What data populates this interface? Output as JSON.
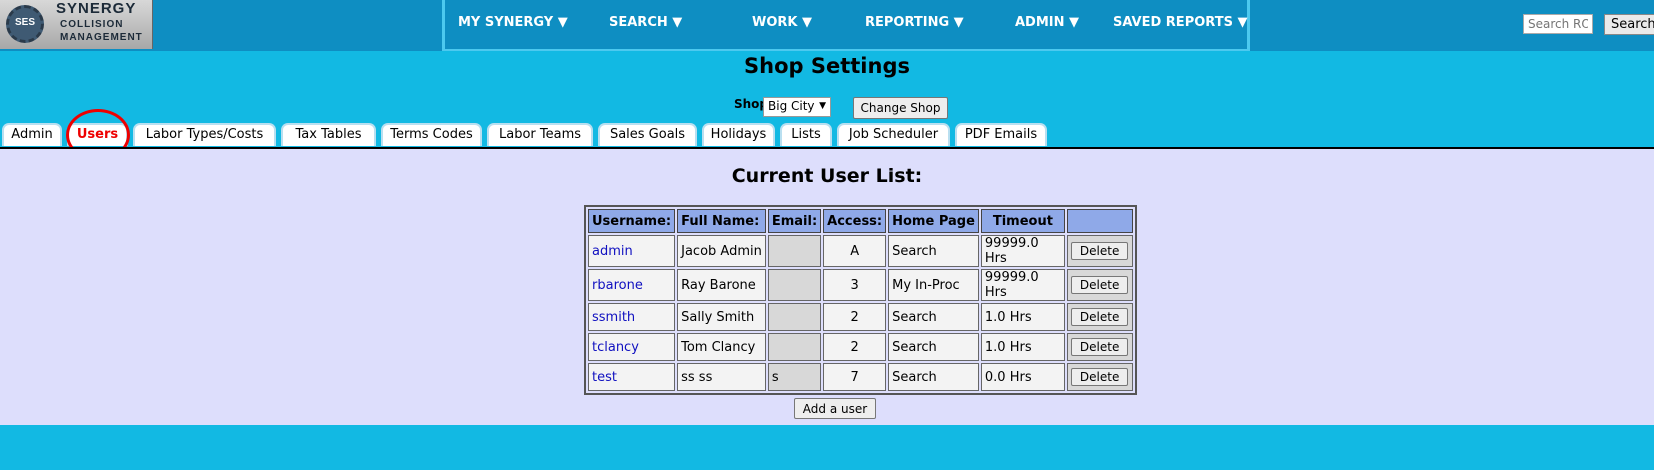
{
  "logo": {
    "mark": "SES",
    "line1": "SYNERGY",
    "line2": "COLLISION",
    "line3": "MANAGEMENT"
  },
  "nav": {
    "items": [
      {
        "label": "MY SYNERGY ▼"
      },
      {
        "label": "SEARCH ▼"
      },
      {
        "label": "WORK ▼"
      },
      {
        "label": "REPORTING ▼"
      },
      {
        "label": "ADMIN ▼"
      },
      {
        "label": "SAVED REPORTS ▼"
      }
    ],
    "search_placeholder": "Search RO",
    "search_button": "Search"
  },
  "page": {
    "title": "Shop Settings",
    "shop_label": "Shop:",
    "shop_value": "Big City",
    "change_shop_button": "Change Shop"
  },
  "tabs": [
    {
      "label": "Admin"
    },
    {
      "label": "Users",
      "active": true
    },
    {
      "label": "Labor Types/Costs"
    },
    {
      "label": "Tax Tables"
    },
    {
      "label": "Terms Codes"
    },
    {
      "label": "Labor Teams"
    },
    {
      "label": "Sales Goals"
    },
    {
      "label": "Holidays"
    },
    {
      "label": "Lists"
    },
    {
      "label": "Job Scheduler"
    },
    {
      "label": "PDF Emails"
    }
  ],
  "user_list": {
    "title": "Current User List:",
    "headers": [
      "Username:",
      "Full Name:",
      "Email:",
      "Access:",
      "Home Page",
      "Timeout",
      ""
    ],
    "rows": [
      {
        "username": "admin",
        "full_name": "Jacob Admin",
        "email": "",
        "access": "A",
        "home_page": "Search",
        "timeout": "99999.0 Hrs",
        "delete": "Delete"
      },
      {
        "username": "rbarone",
        "full_name": "Ray Barone",
        "email": "",
        "access": "3",
        "home_page": "My In-Proc",
        "timeout": "99999.0 Hrs",
        "delete": "Delete"
      },
      {
        "username": "ssmith",
        "full_name": "Sally Smith",
        "email": "",
        "access": "2",
        "home_page": "Search",
        "timeout": "1.0 Hrs",
        "delete": "Delete"
      },
      {
        "username": "tclancy",
        "full_name": "Tom Clancy",
        "email": "",
        "access": "2",
        "home_page": "Search",
        "timeout": "1.0 Hrs",
        "delete": "Delete"
      },
      {
        "username": "test",
        "full_name": "ss ss",
        "email": "s",
        "access": "7",
        "home_page": "Search",
        "timeout": "0.0 Hrs",
        "delete": "Delete"
      }
    ],
    "add_button": "Add a user"
  },
  "colors": {
    "header_bg": "#0e8ec2",
    "page_bg": "#12b9e3",
    "content_bg": "#dddefc",
    "table_header": "#8fa9e8",
    "active_tab": "#ee0000"
  }
}
